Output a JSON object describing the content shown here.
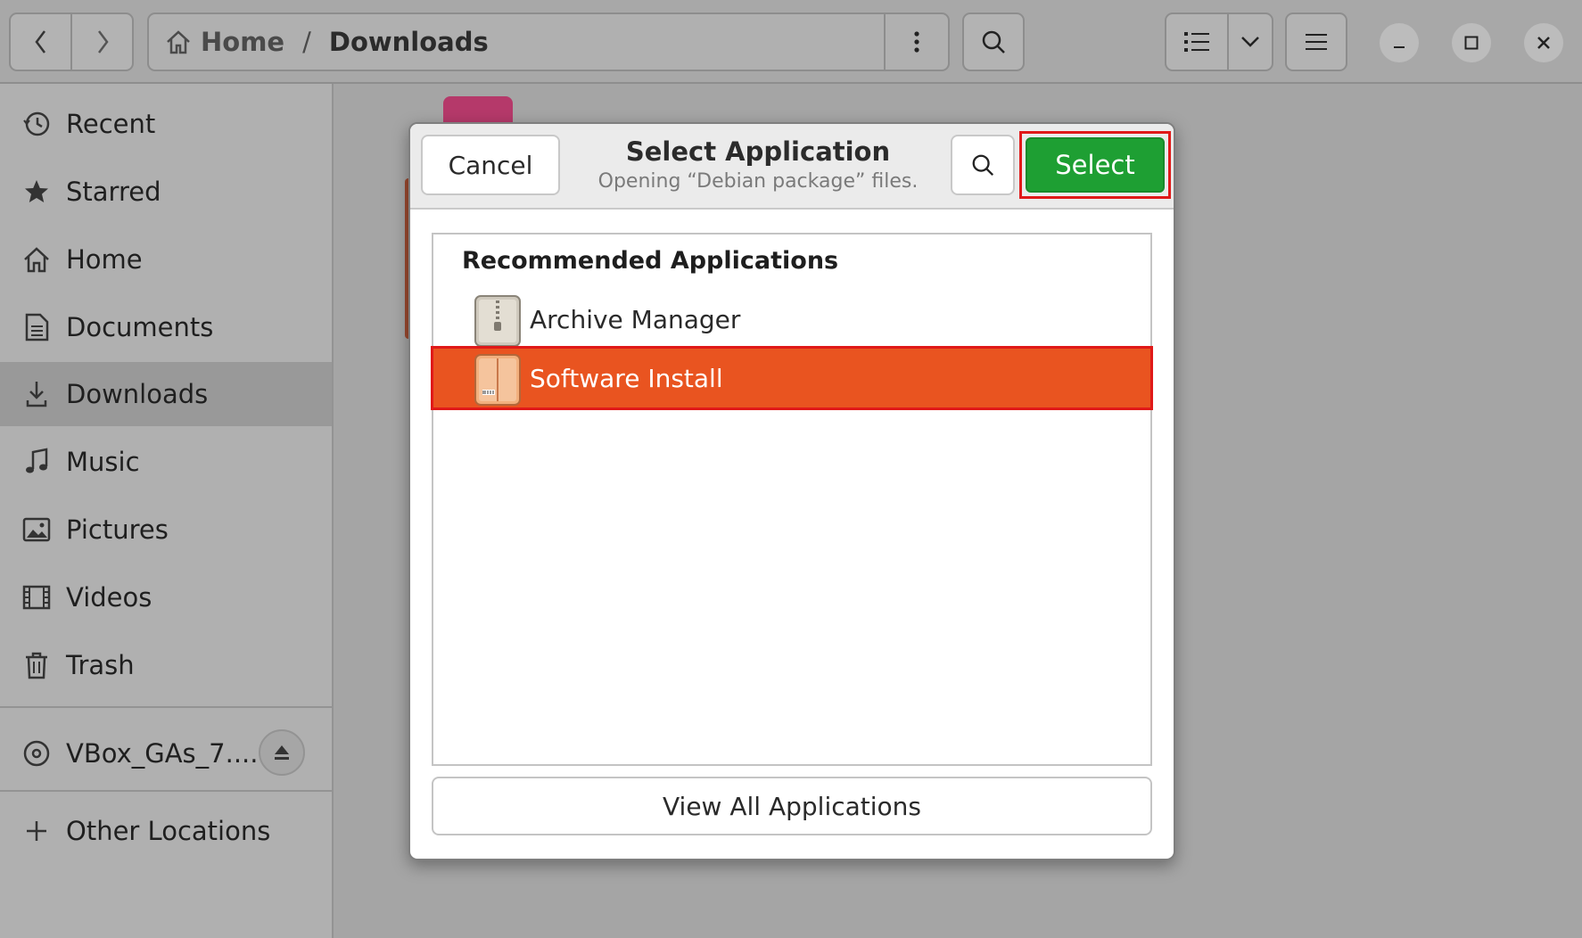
{
  "header": {
    "back_icon": "chevron-left-icon",
    "forward_icon": "chevron-right-icon",
    "path": {
      "home_label": "Home",
      "separator": "/",
      "current": "Downloads"
    },
    "path_menu_icon": "kebab-icon",
    "search_icon": "search-icon",
    "view_icon": "list-view-icon",
    "view_dropdown_icon": "chevron-down-icon",
    "menu_icon": "hamburger-icon",
    "window_controls": [
      "minimize-icon",
      "maximize-icon",
      "close-icon"
    ]
  },
  "sidebar": {
    "items": [
      {
        "label": "Recent",
        "icon": "clock-icon"
      },
      {
        "label": "Starred",
        "icon": "star-icon"
      },
      {
        "label": "Home",
        "icon": "home-icon"
      },
      {
        "label": "Documents",
        "icon": "document-icon"
      },
      {
        "label": "Downloads",
        "icon": "download-icon",
        "active": true
      },
      {
        "label": "Music",
        "icon": "music-icon"
      },
      {
        "label": "Pictures",
        "icon": "picture-icon"
      },
      {
        "label": "Videos",
        "icon": "film-icon"
      },
      {
        "label": "Trash",
        "icon": "trash-icon"
      }
    ],
    "device": {
      "label": "VBox_GAs_7....",
      "icon": "disc-icon",
      "eject_icon": "eject-icon"
    },
    "other": {
      "label": "Other Locations",
      "icon": "plus-icon"
    }
  },
  "dialog": {
    "title": "Select Application",
    "subtitle": "Opening “Debian package” files.",
    "cancel_label": "Cancel",
    "select_label": "Select",
    "search_icon": "search-icon",
    "section_title": "Recommended Applications",
    "apps": [
      {
        "label": "Archive Manager",
        "icon": "archive-manager-icon",
        "selected": false
      },
      {
        "label": "Software Install",
        "icon": "software-install-icon",
        "selected": true
      }
    ],
    "view_all_label": "View All Applications"
  },
  "colors": {
    "accent_orange": "#e95420",
    "select_green": "#1e9f33",
    "highlight_red": "#e01919"
  }
}
